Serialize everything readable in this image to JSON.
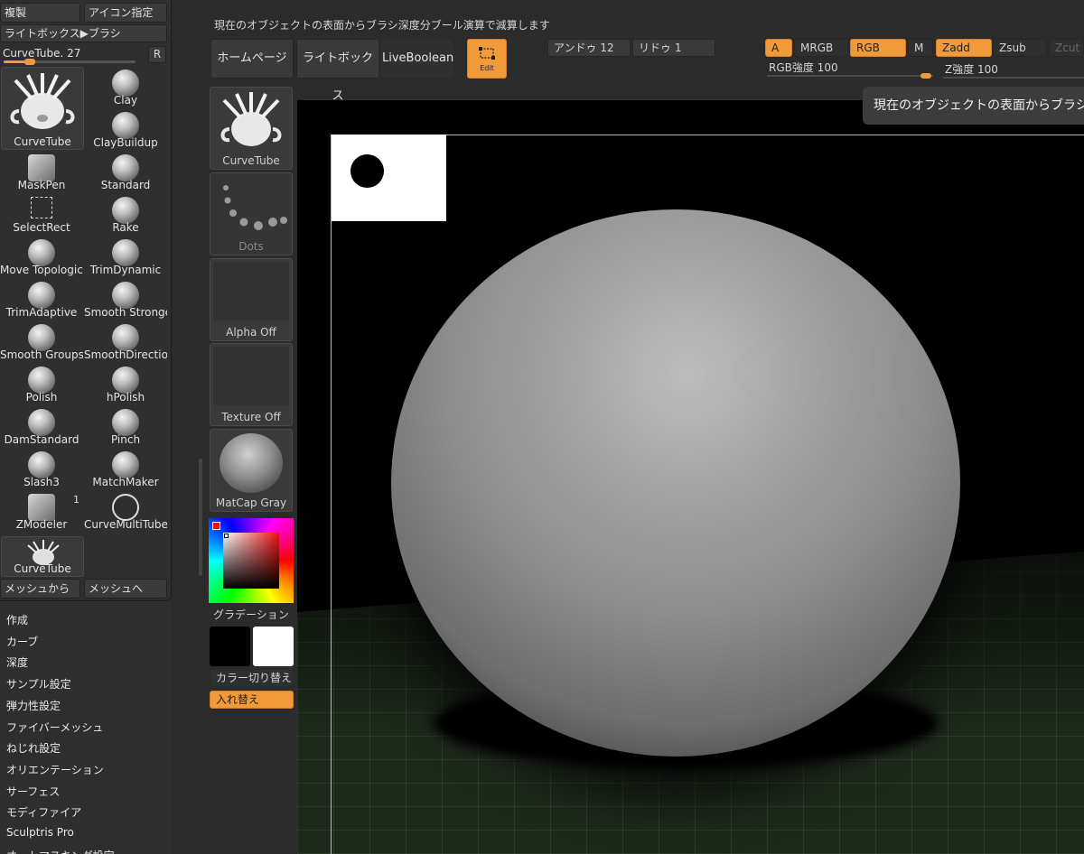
{
  "left_panel": {
    "top_buttons": {
      "duplicate": "複製",
      "icon_assign": "アイコン指定",
      "lightbox_brush": "ライトボックス▶ブラシ"
    },
    "size_slider": {
      "label": "CurveTube. 27",
      "value_fraction": 0.2
    },
    "reset_label": "R",
    "current_brush": "CurveTube",
    "brushes": [
      "Clay",
      "ClayBuildup",
      "MaskPen",
      "Standard",
      "SelectRect",
      "Rake",
      "Move Topologica",
      "TrimDynamic",
      "TrimAdaptive",
      "Smooth Stronge",
      "Smooth Groups",
      "SmoothDirection",
      "Polish",
      "hPolish",
      "DamStandard",
      "Pinch",
      "Slash3",
      "MatchMaker",
      "ZModeler",
      "CurveMultiTube"
    ],
    "zmodeler_badge": "1",
    "recent_brush": "CurveTube",
    "from_mesh": "メッシュから",
    "to_mesh": "メッシュへ",
    "menu_items": [
      "作成",
      "カーブ",
      "深度",
      "サンプル設定",
      "弾力性設定",
      "ファイバーメッシュ",
      "ねじれ設定",
      "オリエンテーション",
      "サーフェス",
      "モディファイア",
      "Sculptris Pro",
      "オートマスキング設定"
    ]
  },
  "mid_col": {
    "brush_tile": "CurveTube",
    "stroke_tile": "Dots",
    "alpha_tile": "Alpha Off",
    "texture_tile": "Texture Off",
    "material_tile": "MatCap Gray",
    "gradient_label": "グラデーション",
    "color_switch": "カラー切り替え",
    "swap": "入れ替え"
  },
  "top_bar": {
    "info_text": "現在のオブジェクトの表面からブラシ深度分ブール演算で減算します",
    "home_page": "ホームページ",
    "lightbox": "ライトボックス",
    "live_boolean": "LiveBoolean",
    "edit": "Edit",
    "undo": "アンドゥ 12",
    "redo": "リドゥ 1",
    "a": "A",
    "mrgb": "MRGB",
    "rgb": "RGB",
    "m": "M",
    "zadd": "Zadd",
    "zsub": "Zsub",
    "zcut": "Zcut",
    "rgb_intensity": "RGB強度 100",
    "z_intensity": "Z強度 100"
  },
  "tooltip": "現在のオブジェクトの表面からブラシ",
  "colors": {
    "accent": "#f19a3a",
    "primary_color": "#000000",
    "secondary_color": "#ffffff"
  }
}
